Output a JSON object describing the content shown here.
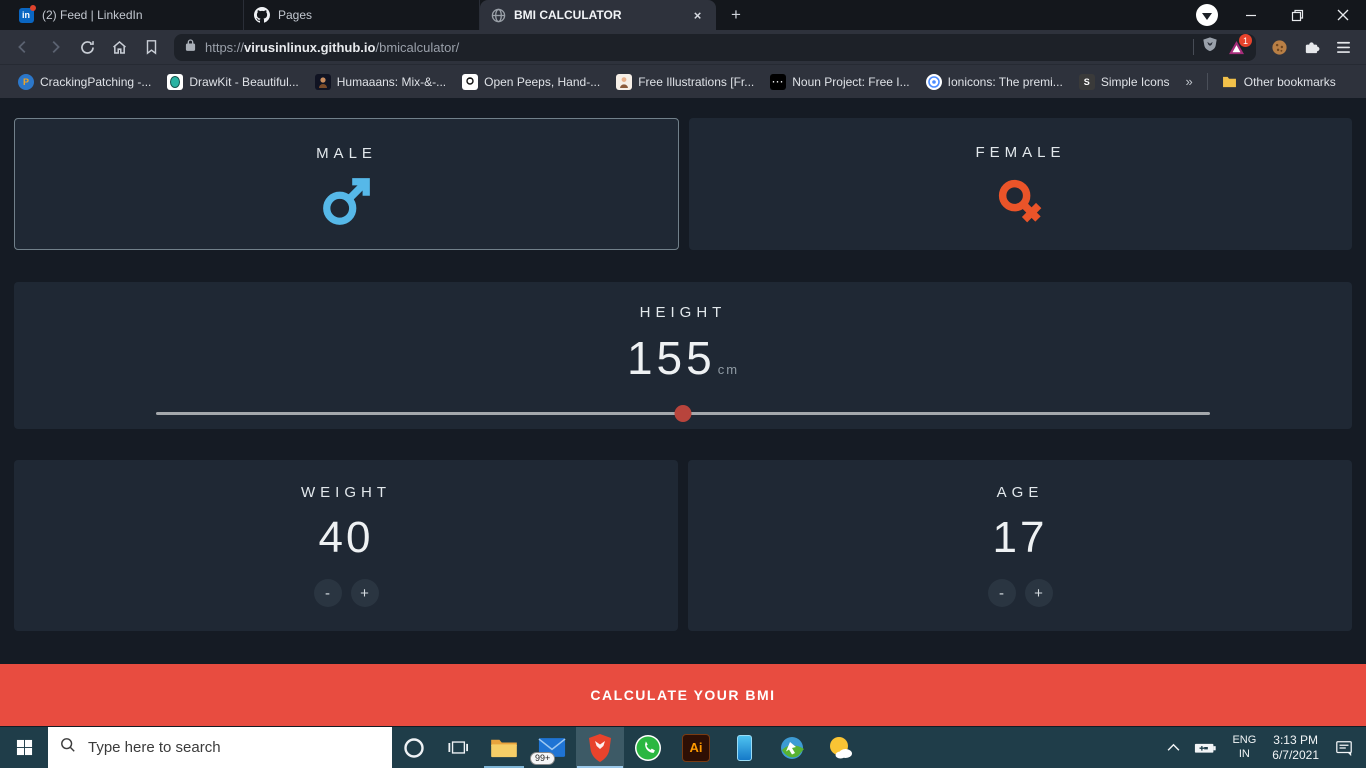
{
  "browser": {
    "tab_bar": {
      "tabs": [
        {
          "title": "(2) Feed | LinkedIn"
        },
        {
          "title": "Pages"
        },
        {
          "title": "BMI CALCULATOR"
        }
      ],
      "new_tab_glyph": "+",
      "close_glyph": "×"
    },
    "toolbar": {
      "url_scheme": "https://",
      "url_host": "virusinlinux.github.io",
      "url_path": "/bmicalculator/",
      "rewards_badge": "1"
    },
    "bookmarks_bar": {
      "items": [
        {
          "label": "CrackingPatching -..."
        },
        {
          "label": "DrawKit - Beautiful..."
        },
        {
          "label": "Humaaans: Mix-&-..."
        },
        {
          "label": "Open Peeps, Hand-..."
        },
        {
          "label": "Free Illustrations [Fr..."
        },
        {
          "label": "Noun Project: Free I..."
        },
        {
          "label": "Ionicons: The premi..."
        },
        {
          "label": "Simple Icons"
        }
      ],
      "overflow_glyph": "»",
      "other_bookmarks_label": "Other bookmarks"
    }
  },
  "app": {
    "gender": {
      "male_label": "MALE",
      "female_label": "FEMALE"
    },
    "height": {
      "label": "HEIGHT",
      "value": "155",
      "unit": "cm",
      "slider_percent": 50
    },
    "weight": {
      "label": "WEIGHT",
      "value": "40",
      "minus_glyph": "-",
      "plus_glyph": "+"
    },
    "age": {
      "label": "AGE",
      "value": "17",
      "minus_glyph": "-",
      "plus_glyph": "+"
    },
    "calculate_label": "CALCULATE YOUR BMI",
    "colors": {
      "male_icon": "#56b8e8",
      "female_icon": "#ea5429",
      "slider_thumb": "#b8443c",
      "calculate_bg": "#e84c40",
      "card_bg": "#1f2834",
      "page_bg": "#151b24"
    }
  },
  "taskbar": {
    "search_placeholder": "Type here to search",
    "mail_badge": "99+",
    "tray": {
      "language": "ENG",
      "region": "IN",
      "time": "3:13 PM",
      "date": "6/7/2021"
    }
  }
}
